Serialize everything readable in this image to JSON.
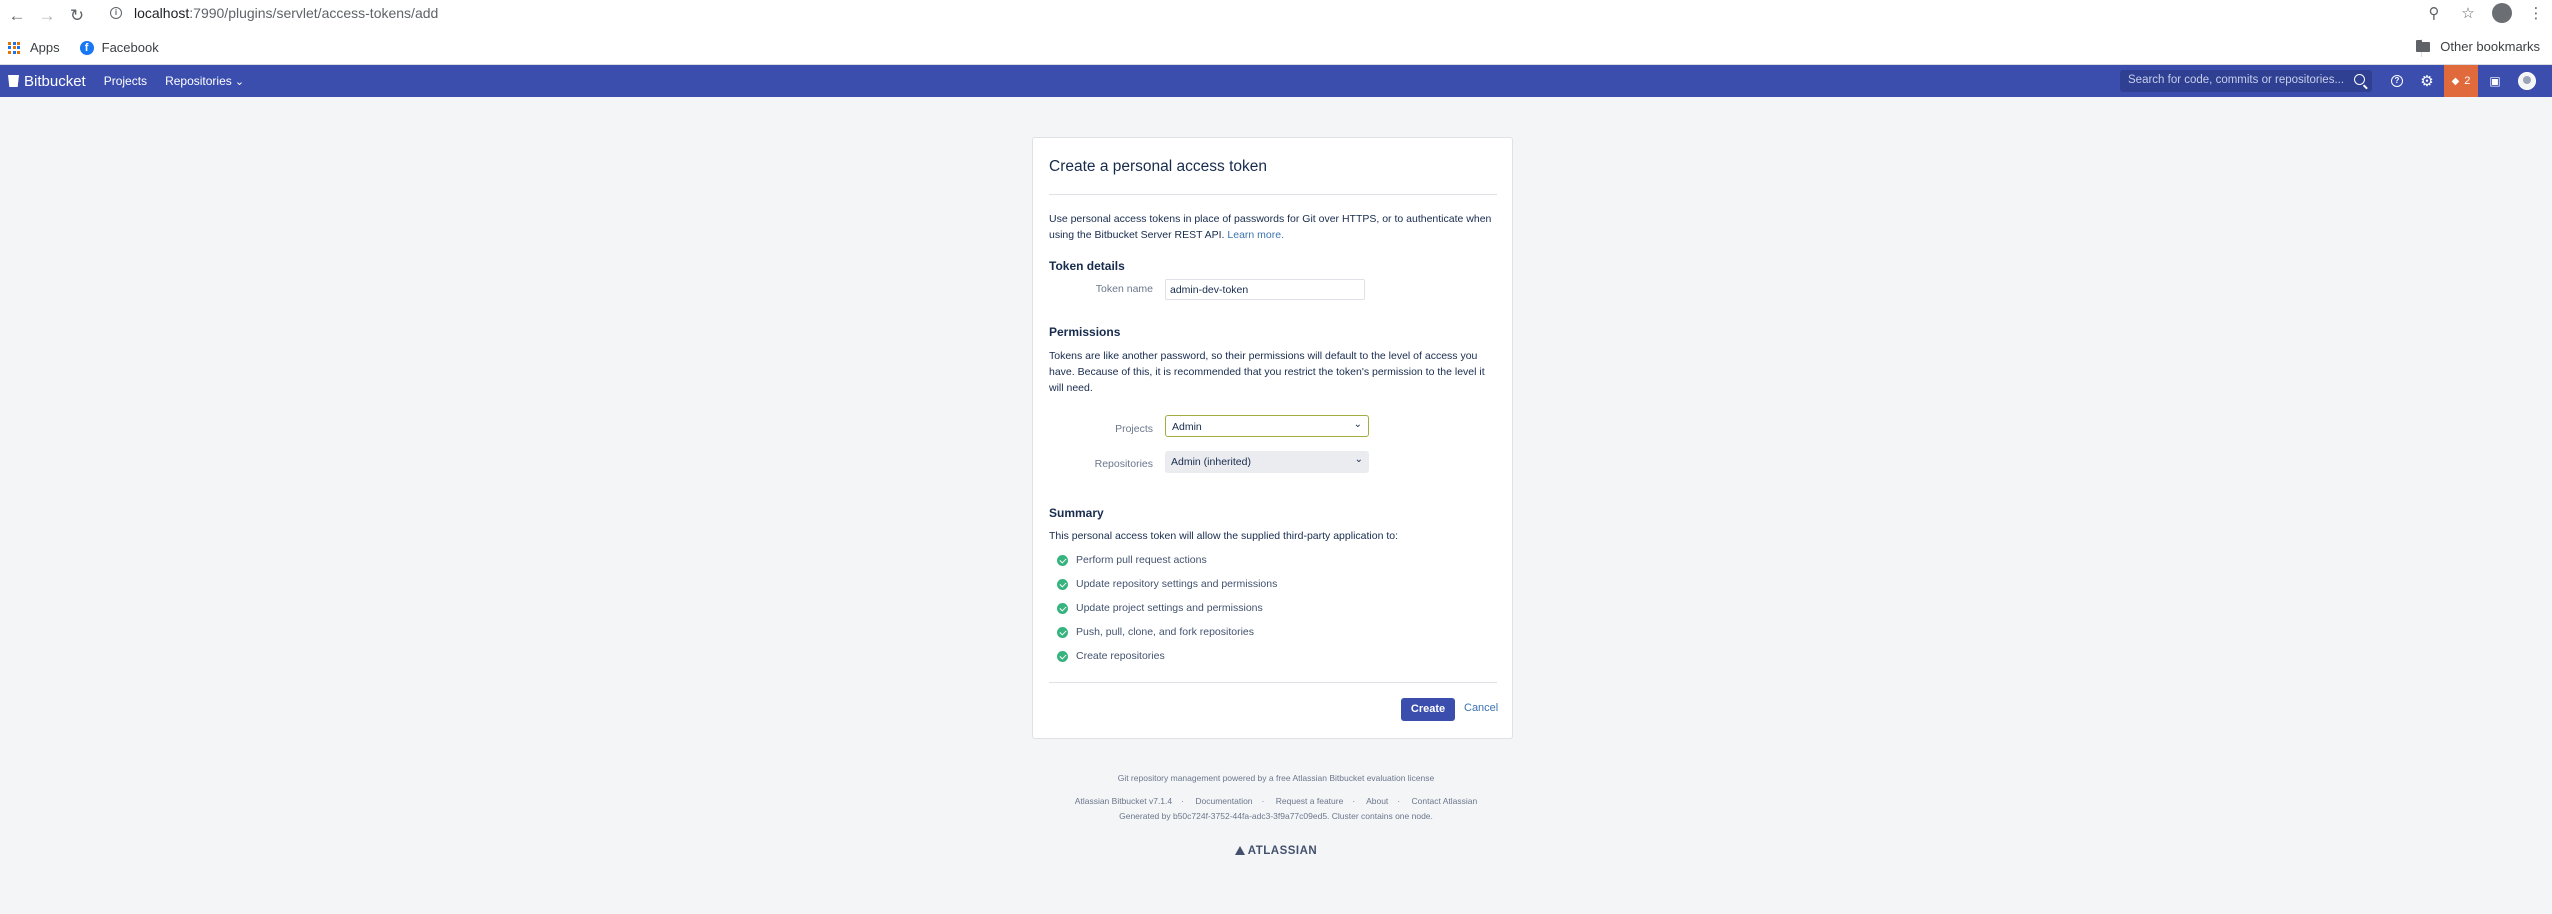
{
  "browser": {
    "url_host": "localhost",
    "url_path": ":7990/plugins/servlet/access-tokens/add",
    "bookmarks": [
      {
        "label": "Apps",
        "icon": "apps-grid-icon"
      },
      {
        "label": "Facebook",
        "icon": "facebook-icon"
      }
    ],
    "other_bookmarks": "Other bookmarks"
  },
  "header": {
    "logo": "Bitbucket",
    "nav": [
      "Projects",
      "Repositories"
    ],
    "search_placeholder": "Search for code, commits or repositories...",
    "notification_count": "2"
  },
  "form": {
    "title": "Create a personal access token",
    "intro": "Use personal access tokens in place of passwords for Git over HTTPS, or to authenticate when using the Bitbucket Server REST API.",
    "learn_more": "Learn more.",
    "token_details_heading": "Token details",
    "token_name_label": "Token name",
    "token_name_value": "admin-dev-token",
    "permissions_heading": "Permissions",
    "permissions_text": "Tokens are like another password, so their permissions will default to the level of access you have. Because of this, it is recommended that you restrict the token's permission to the level it will need.",
    "projects_label": "Projects",
    "projects_value": "Admin",
    "repositories_label": "Repositories",
    "repositories_value": "Admin (inherited)",
    "summary_heading": "Summary",
    "summary_intro": "This personal access token will allow the supplied third-party application to:",
    "summary_items": [
      "Perform pull request actions",
      "Update repository settings and permissions",
      "Update project settings and permissions",
      "Push, pull, clone, and fork repositories",
      "Create repositories"
    ],
    "create_label": "Create",
    "cancel_label": "Cancel"
  },
  "footer": {
    "license": "Git repository management powered by a free Atlassian Bitbucket evaluation license",
    "links": [
      "Atlassian Bitbucket v7.1.4",
      "Documentation",
      "Request a feature",
      "About",
      "Contact Atlassian"
    ],
    "generated": "Generated by b50c724f-3752-44fa-adc3-3f9a77c09ed5. Cluster contains one node.",
    "brand": "ATLASSIAN"
  },
  "colors": {
    "header_bg": "#3b4eae",
    "primary_button": "#3b4eae",
    "link": "#3b73af",
    "success_check": "#36b37e",
    "notification": "#e06a3b"
  }
}
